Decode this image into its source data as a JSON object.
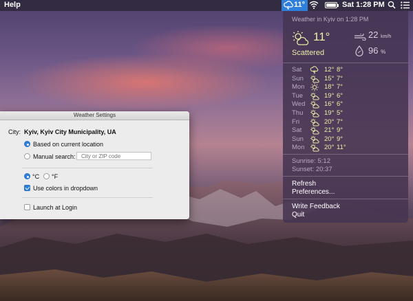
{
  "menubar": {
    "help": "Help",
    "weather_temp": "11°",
    "datetime": "Sat 1:28 PM"
  },
  "weather": {
    "header": "Weather in Kyiv on 1:28 PM",
    "temp": "11°",
    "condition": "Scattered",
    "wind_value": "22",
    "wind_unit": "km/h",
    "humidity_value": "96",
    "humidity_unit": "%",
    "forecast": [
      {
        "day": "Sat",
        "icon": "cloud-storm-icon",
        "hi": "12°",
        "lo": "8°"
      },
      {
        "day": "Sun",
        "icon": "partly-cloudy-icon",
        "hi": "15°",
        "lo": "7°"
      },
      {
        "day": "Mon",
        "icon": "sun-icon",
        "hi": "18°",
        "lo": "7°"
      },
      {
        "day": "Tue",
        "icon": "partly-cloudy-icon",
        "hi": "19°",
        "lo": "6°"
      },
      {
        "day": "Wed",
        "icon": "partly-cloudy-icon",
        "hi": "16°",
        "lo": "6°"
      },
      {
        "day": "Thu",
        "icon": "partly-cloudy-icon",
        "hi": "19°",
        "lo": "5°"
      },
      {
        "day": "Fri",
        "icon": "partly-cloudy-icon",
        "hi": "20°",
        "lo": "7°"
      },
      {
        "day": "Sat",
        "icon": "partly-cloudy-icon",
        "hi": "21°",
        "lo": "9°"
      },
      {
        "day": "Sun",
        "icon": "partly-cloudy-icon",
        "hi": "20°",
        "lo": "9°"
      },
      {
        "day": "Mon",
        "icon": "partly-cloudy-icon",
        "hi": "20°",
        "lo": "11°"
      }
    ],
    "sunrise": "Sunrise: 5:12",
    "sunset": "Sunset: 20:37",
    "menu": {
      "refresh": "Refresh",
      "preferences": "Preferences...",
      "write_feedback": "Write Feedback",
      "quit": "Quit"
    }
  },
  "settings": {
    "title": "Weather Settings",
    "city_label": "City:",
    "city_value": "Kyiv, Kyiv City Municipality, UA",
    "based_on_location": "Based on current location",
    "manual_search": "Manual search:",
    "search_placeholder": "City or ZIP code",
    "celsius": "°C",
    "fahrenheit": "°F",
    "use_colors": "Use colors in dropdown",
    "launch_at_login": "Launch at Login"
  },
  "colors": {
    "accent": "#2f7fdc",
    "temperature_text": "#e9efa6"
  }
}
